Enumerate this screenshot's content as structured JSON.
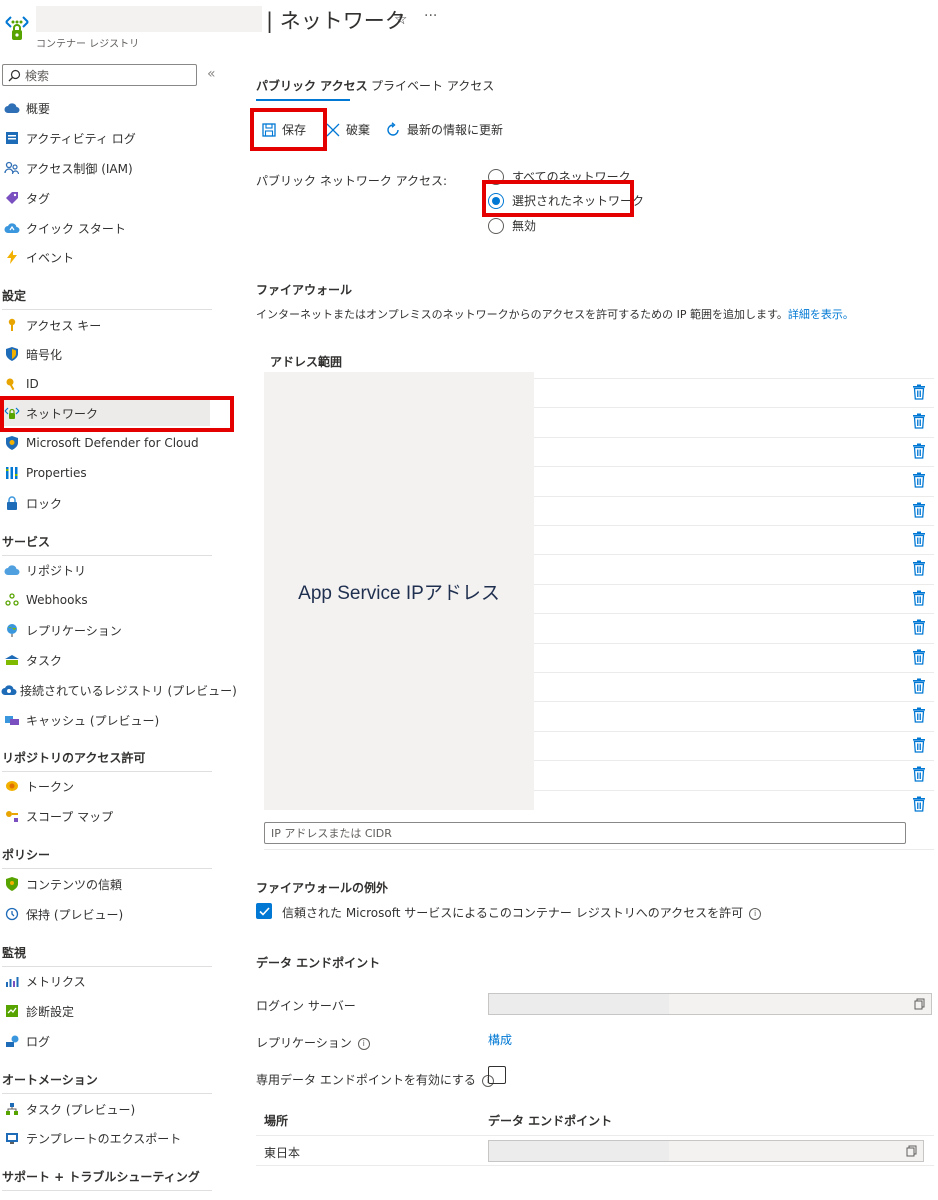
{
  "header": {
    "title": "| ネットワーク",
    "subtitle": "コンテナー レジストリ",
    "star": "☆",
    "more": "···"
  },
  "sidebar": {
    "search_placeholder": "検索",
    "collapse": "«",
    "items": [
      {
        "label": "概要",
        "icon": "cloud-icon"
      },
      {
        "label": "アクティビティ ログ",
        "icon": "activity-log-icon"
      },
      {
        "label": "アクセス制御 (IAM)",
        "icon": "people-icon"
      },
      {
        "label": "タグ",
        "icon": "tag-icon"
      },
      {
        "label": "クイック スタート",
        "icon": "quickstart-cloud-icon"
      },
      {
        "label": "イベント",
        "icon": "lightning-icon"
      }
    ],
    "sections": {
      "settings": "設定",
      "services": "サービス",
      "repo_permissions": "リポジトリのアクセス許可",
      "policies": "ポリシー",
      "monitoring": "監視",
      "automation": "オートメーション",
      "support": "サポート + トラブルシューティング"
    },
    "settings_items": [
      {
        "label": "アクセス キー",
        "icon": "key-icon"
      },
      {
        "label": "暗号化",
        "icon": "shield-icon"
      },
      {
        "label": "ID",
        "icon": "identity-key-icon"
      },
      {
        "label": "ネットワーク",
        "icon": "network-icon"
      },
      {
        "label": "Microsoft Defender for Cloud",
        "icon": "defender-shield-icon"
      },
      {
        "label": "Properties",
        "icon": "properties-icon"
      },
      {
        "label": "ロック",
        "icon": "lock-icon"
      }
    ],
    "services_items": [
      {
        "label": "リポジトリ",
        "icon": "repository-cloud-icon"
      },
      {
        "label": "Webhooks",
        "icon": "webhook-icon"
      },
      {
        "label": "レプリケーション",
        "icon": "globe-icon"
      },
      {
        "label": "タスク",
        "icon": "task-icon"
      },
      {
        "label": "接続されているレジストリ (プレビュー)",
        "icon": "connected-registry-icon"
      },
      {
        "label": "キャッシュ (プレビュー)",
        "icon": "cache-icon"
      }
    ],
    "repo_items": [
      {
        "label": "トークン",
        "icon": "token-icon"
      },
      {
        "label": "スコープ マップ",
        "icon": "scope-map-icon"
      }
    ],
    "policy_items": [
      {
        "label": "コンテンツの信頼",
        "icon": "content-trust-icon"
      },
      {
        "label": "保持 (プレビュー)",
        "icon": "retention-icon"
      }
    ],
    "monitoring_items": [
      {
        "label": "メトリクス",
        "icon": "metrics-icon"
      },
      {
        "label": "診断設定",
        "icon": "diagnostic-icon"
      },
      {
        "label": "ログ",
        "icon": "logs-icon"
      }
    ],
    "automation_items": [
      {
        "label": "タスク (プレビュー)",
        "icon": "task-preview-icon"
      },
      {
        "label": "テンプレートのエクスポート",
        "icon": "export-template-icon"
      }
    ]
  },
  "tabs": [
    {
      "label": "パブリック アクセス",
      "active": true
    },
    {
      "label": "プライベート アクセス",
      "active": false
    }
  ],
  "toolbar": {
    "save": "保存",
    "discard": "破棄",
    "refresh": "最新の情報に更新"
  },
  "public_access": {
    "label": "パブリック ネットワーク アクセス:",
    "options": [
      {
        "label": "すべてのネットワーク",
        "selected": false
      },
      {
        "label": "選択されたネットワーク",
        "selected": true
      },
      {
        "label": "無効",
        "selected": false
      }
    ]
  },
  "firewall": {
    "heading": "ファイアウォール",
    "description": "インターネットまたはオンプレミスのネットワークからのアクセスを許可するための IP 範囲を追加します。",
    "learn_more": "詳細を表示。",
    "column": "アドレス範囲",
    "overlay_text": "App Service IPアドレス",
    "input_placeholder": "IP アドレスまたは CIDR"
  },
  "exceptions": {
    "heading": "ファイアウォールの例外",
    "checkbox_label": "信頼された Microsoft サービスによるこのコンテナー レジストリへのアクセスを許可",
    "checked": true
  },
  "data_endpoint": {
    "heading": "データ エンドポイント",
    "login_server_label": "ログイン サーバー",
    "replication_label": "レプリケーション",
    "replication_link": "構成",
    "dedicated_label": "専用データ エンドポイントを有効にする",
    "dedicated_checked": false,
    "table_headers": [
      "場所",
      "データ エンドポイント"
    ],
    "rows": [
      {
        "location": "東日本"
      }
    ]
  }
}
